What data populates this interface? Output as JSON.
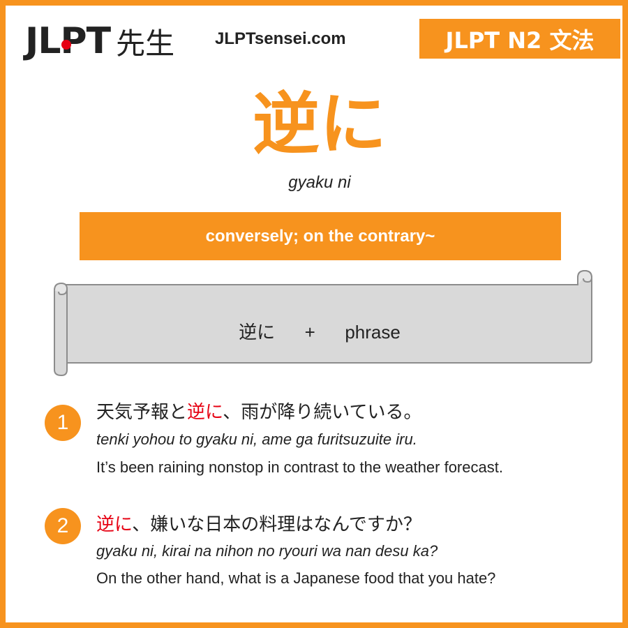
{
  "header": {
    "logo_latin": "JLPT",
    "logo_kanji": "先生",
    "site": "JLPTsensei.com",
    "level_badge": "JLPT N2 文法"
  },
  "grammar": {
    "point": "逆に",
    "romaji": "gyaku ni",
    "meaning": "conversely; on the contrary~"
  },
  "formula": {
    "part1": "逆に",
    "plus": "+",
    "part2": "phrase"
  },
  "examples": [
    {
      "number": "1",
      "jp_before": "天気予報と",
      "jp_highlight": "逆に",
      "jp_after": "、雨が降り続いている。",
      "romaji": "tenki yohou to gyaku ni, ame ga furitsuzuite iru.",
      "english": "It’s been raining nonstop in contrast to the weather forecast."
    },
    {
      "number": "2",
      "jp_before": "",
      "jp_highlight": "逆に",
      "jp_after": "、嫌いな日本の料理はなんですか？",
      "romaji": "gyaku ni, kirai na nihon no ryouri wa nan desu ka?",
      "english": "On the other hand, what is a Japanese food that you hate?"
    }
  ],
  "colors": {
    "accent": "#f7931e",
    "highlight": "#e60012",
    "scroll_fill": "#d9d9d9",
    "text": "#222222"
  }
}
